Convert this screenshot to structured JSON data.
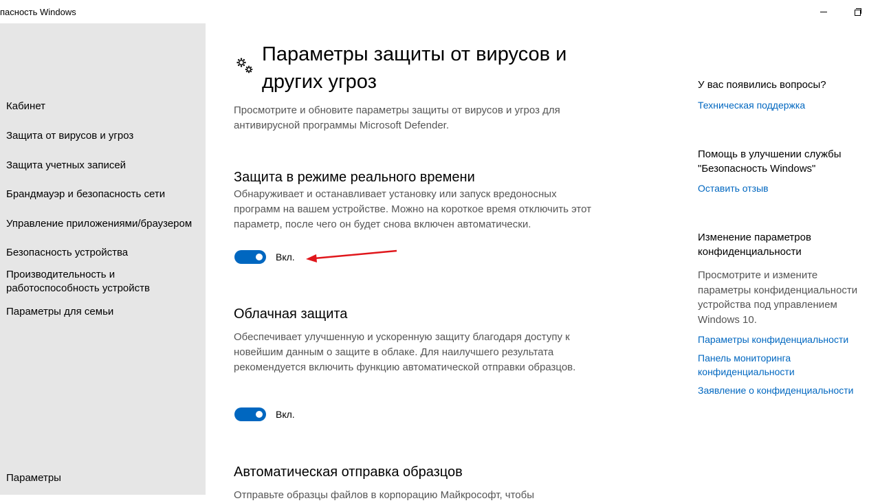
{
  "window": {
    "title": "пасность Windows"
  },
  "sidebar": {
    "items": [
      {
        "label": "Кабинет"
      },
      {
        "label": "Защита от вирусов и угроз"
      },
      {
        "label": "Защита учетных записей"
      },
      {
        "label": "Брандмауэр и безопасность сети"
      },
      {
        "label": "Управление приложениями/браузером"
      },
      {
        "label": "Безопасность устройства"
      },
      {
        "label": "Производительность и работоспособность устройств"
      },
      {
        "label": "Параметры для семьи"
      }
    ],
    "settings_label": "Параметры"
  },
  "main": {
    "title": "Параметры защиты от вирусов и других угроз",
    "description": "Просмотрите и обновите параметры защиты от вирусов и угроз для антивирусной программы Microsoft Defender.",
    "sections": [
      {
        "heading": "Защита в режиме реального времени",
        "text": "Обнаруживает и останавливает установку или запуск вредоносных программ на вашем устройстве. Можно на короткое время отключить этот параметр, после чего он будет снова включен автоматически.",
        "toggle_label": "Вкл.",
        "toggle_on": true
      },
      {
        "heading": "Облачная защита",
        "text": "Обеспечивает улучшенную и ускоренную защиту благодаря доступу к новейшим данным о защите в облаке. Для наилучшего результата рекомендуется включить функцию автоматической отправки образцов.",
        "toggle_label": "Вкл.",
        "toggle_on": true
      },
      {
        "heading": "Автоматическая отправка образцов",
        "text": "Отправьте образцы файлов в корпорацию Майкрософт, чтобы"
      }
    ]
  },
  "right": {
    "questions_heading": "У вас появились вопросы?",
    "support_link": "Техническая поддержка",
    "improve_heading": "Помощь в улучшении службы \"Безопасность Windows\"",
    "feedback_link": "Оставить отзыв",
    "privacy_heading": "Изменение параметров конфиденциальности",
    "privacy_text": "Просмотрите и измените параметры конфиденциальности устройства под управлением Windows 10.",
    "privacy_links": [
      "Параметры конфиденциальности",
      "Панель мониторинга конфиденциальности",
      "Заявление о конфиденциальности"
    ]
  },
  "colors": {
    "accent": "#0067c0",
    "sidebar_bg": "#e6e6e6",
    "annotation_arrow": "#e0161b"
  },
  "icons": {
    "page_icon": "gear-icon",
    "annotation": "red-arrow"
  }
}
